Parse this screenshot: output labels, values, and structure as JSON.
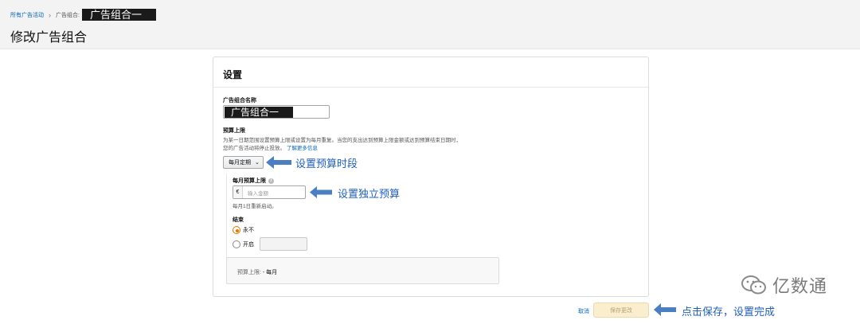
{
  "breadcrumb": {
    "all_campaigns": "所有广告活动",
    "separator": "›",
    "ad_group_label": "广告组合:",
    "ad_group_name": "广告组合一"
  },
  "page_title": "修改广告组合",
  "card": {
    "title": "设置",
    "name_label": "广告组合名称",
    "name_value": "广告组合一",
    "budget_cap_label": "预算上限",
    "budget_desc_1": "为某一日期范围设置预算上限或设置为每月重复。当您的支出达到预算上限金额或达到预算结束日期时，",
    "budget_desc_2": "您的广告活动将停止投放。",
    "learn_more": "了解更多信息",
    "period_select": "每月定期",
    "monthly_cap_label": "每月预算上限",
    "currency": "€",
    "amount_placeholder": "输入金额",
    "restart_note": "每月1日重新启动。",
    "end_label": "结束",
    "end_never": "永不",
    "end_on": "开启",
    "summary_label": "预算上限:",
    "summary_value": "- 每月"
  },
  "annotations": {
    "period": "设置预算时段",
    "budget": "设置独立预算",
    "save": "点击保存，设置完成"
  },
  "footer": {
    "cancel": "取消",
    "save": "保存更改"
  },
  "watermark": "亿数通",
  "colors": {
    "link": "#0066c0",
    "annotation": "#1f5fbf",
    "arrow": "#4a7fc1",
    "radio_checked": "#e77600",
    "save_bg": "#fbeecf"
  }
}
